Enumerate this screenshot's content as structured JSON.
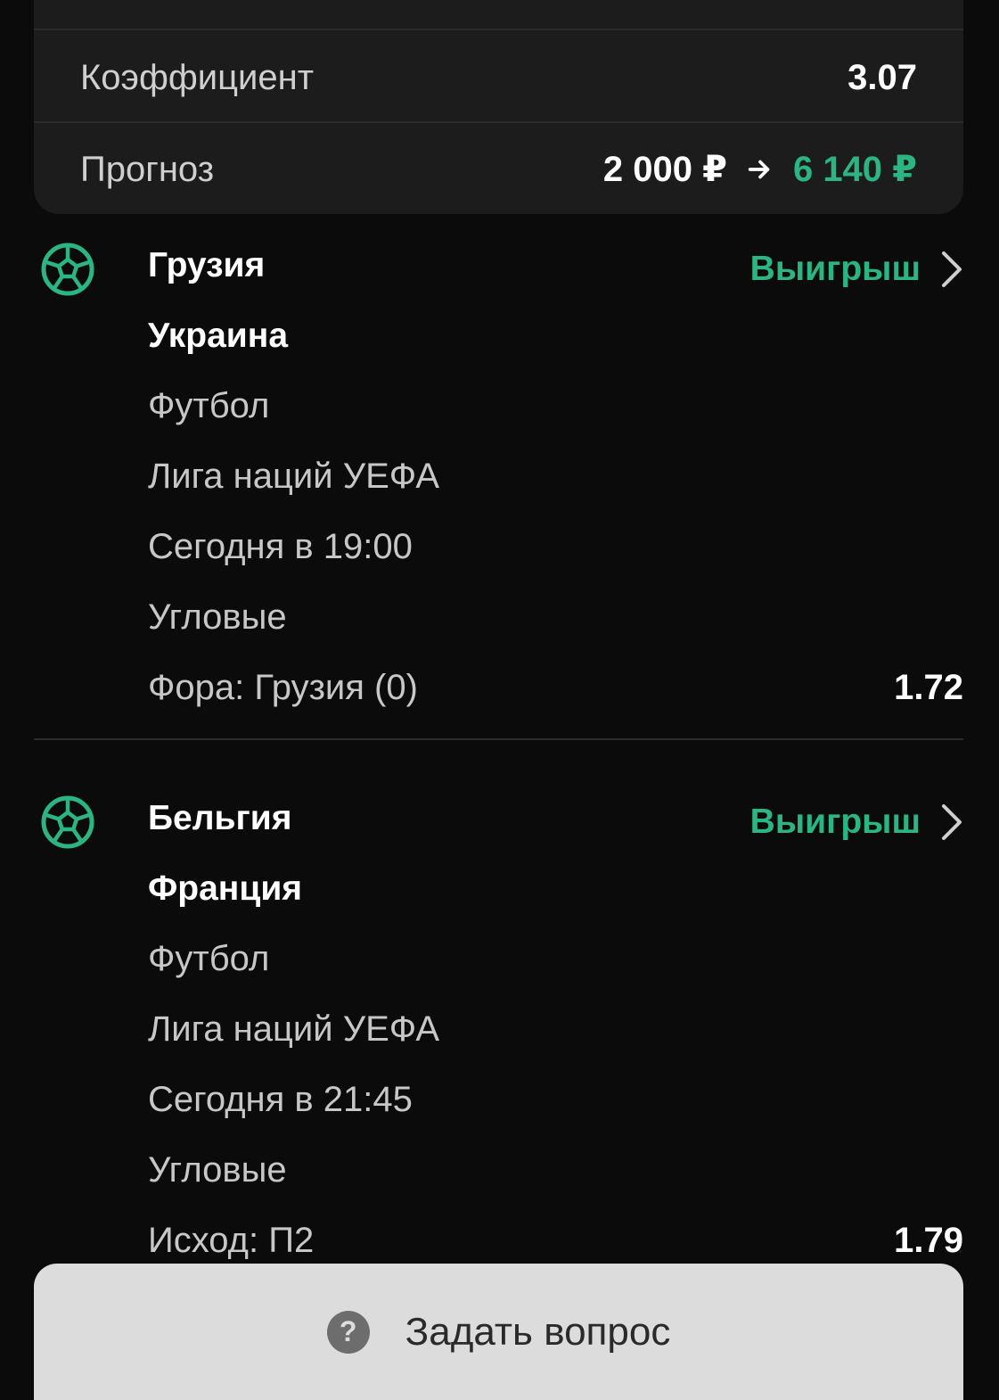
{
  "summary": {
    "coef_label": "Коэффициент",
    "coef_value": "3.07",
    "forecast_label": "Прогноз",
    "stake": "2 000 ₽",
    "payout": "6 140 ₽"
  },
  "events": [
    {
      "icon": "soccer-ball-icon",
      "team_home": "Грузия",
      "team_away": "Украина",
      "status": "Выигрыш",
      "sport": "Футбол",
      "league": "Лига наций УЕФА",
      "time": "Сегодня в 19:00",
      "market": "Угловые",
      "selection": "Фора: Грузия (0)",
      "odds": "1.72"
    },
    {
      "icon": "soccer-ball-icon",
      "team_home": "Бельгия",
      "team_away": "Франция",
      "status": "Выигрыш",
      "sport": "Футбол",
      "league": "Лига наций УЕФА",
      "time": "Сегодня в 21:45",
      "market": "Угловые",
      "selection": "Исход: П2",
      "odds": "1.79"
    }
  ],
  "ask_button": {
    "label": "Задать вопрос",
    "icon": "question-icon"
  },
  "colors": {
    "accent_green": "#2bb582",
    "background": "#0b0b0b",
    "card": "#1c1c1c"
  }
}
